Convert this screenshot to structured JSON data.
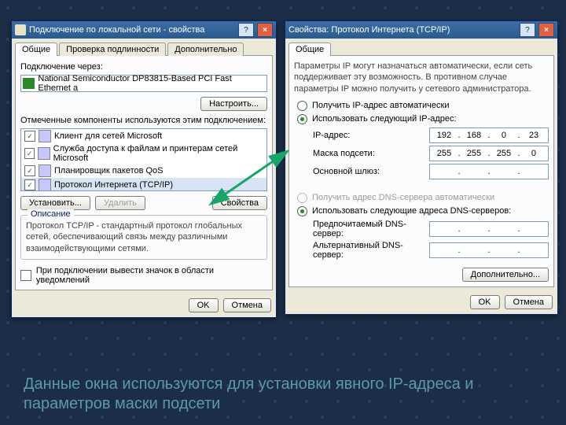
{
  "left": {
    "title": "Подключение по локальной сети - свойства",
    "tabs": [
      "Общие",
      "Проверка подлинности",
      "Дополнительно"
    ],
    "connect_via_label": "Подключение через:",
    "adapter": "National Semiconductor DP83815-Based PCI Fast Ethernet a",
    "configure_btn": "Настроить...",
    "components_label": "Отмеченные компоненты используются этим подключением:",
    "items": [
      {
        "checked": true,
        "label": "Клиент для сетей Microsoft"
      },
      {
        "checked": true,
        "label": "Служба доступа к файлам и принтерам сетей Microsoft"
      },
      {
        "checked": true,
        "label": "Планировщик пакетов QoS"
      },
      {
        "checked": true,
        "label": "Протокол Интернета (TCP/IP)",
        "selected": true
      }
    ],
    "install_btn": "Установить...",
    "remove_btn": "Удалить",
    "props_btn": "Свойства",
    "desc_title": "Описание",
    "desc_text": "Протокол TCP/IP - стандартный протокол глобальных сетей, обеспечивающий связь между различными взаимодействующими сетями.",
    "tray_chk": "При подключении вывести значок в области уведомлений",
    "ok": "OK",
    "cancel": "Отмена"
  },
  "right": {
    "title": "Свойства: Протокол Интернета (TCP/IP)",
    "tab": "Общие",
    "intro": "Параметры IP могут назначаться автоматически, если сеть поддерживает эту возможность. В противном случае параметры IP можно получить у сетевого администратора.",
    "r_auto": "Получить IP-адрес автоматически",
    "r_manual": "Использовать следующий IP-адрес:",
    "ip_label": "IP-адрес:",
    "ip": [
      "192",
      "168",
      "0",
      "23"
    ],
    "mask_label": "Маска подсети:",
    "mask": [
      "255",
      "255",
      "255",
      "0"
    ],
    "gw_label": "Основной шлюз:",
    "gw": [
      "",
      "",
      "",
      ""
    ],
    "dns_auto": "Получить адрес DNS-сервера автоматически",
    "dns_manual": "Использовать следующие адреса DNS-серверов:",
    "dns1_label": "Предпочитаемый DNS-сервер:",
    "dns2_label": "Альтернативный DNS-сервер:",
    "adv_btn": "Дополнительно...",
    "ok": "OK",
    "cancel": "Отмена"
  },
  "caption": "Данные окна используются для установки явного IP-адреса и параметров маски подсети"
}
